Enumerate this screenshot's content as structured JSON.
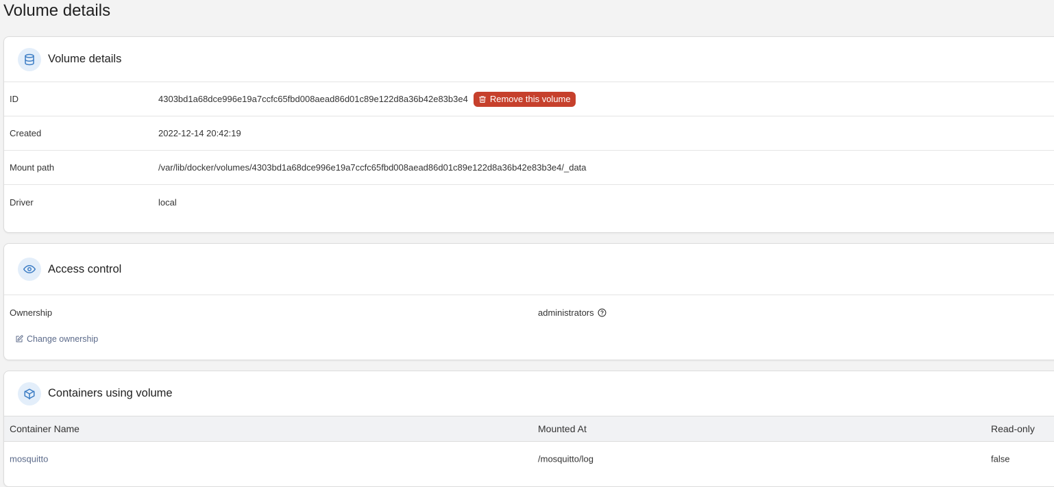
{
  "page": {
    "title": "Volume details"
  },
  "details": {
    "title": "Volume details",
    "id_label": "ID",
    "id_value": "4303bd1a68dce996e19a7ccfc65fbd008aead86d01c89e122d8a36b42e83b3e4",
    "remove_label": "Remove this volume",
    "created_label": "Created",
    "created_value": "2022-12-14 20:42:19",
    "mount_label": "Mount path",
    "mount_value": "/var/lib/docker/volumes/4303bd1a68dce996e19a7ccfc65fbd008aead86d01c89e122d8a36b42e83b3e4/_data",
    "driver_label": "Driver",
    "driver_value": "local"
  },
  "access": {
    "title": "Access control",
    "ownership_label": "Ownership",
    "ownership_value": "administrators",
    "change_label": "Change ownership"
  },
  "containers": {
    "title": "Containers using volume",
    "columns": [
      "Container Name",
      "Mounted At",
      "Read-only"
    ],
    "rows": [
      {
        "name": "mosquitto",
        "mounted_at": "/mosquitto/log",
        "read_only": "false"
      }
    ]
  },
  "colors": {
    "danger": "#c6402c",
    "link": "#5b6a8a",
    "icon_accent": "#3b7cc4",
    "icon_bg": "#e3eefa"
  },
  "icons": {
    "details": "database-icon",
    "access": "eye-icon",
    "containers": "box-icon",
    "remove": "trash-icon",
    "help": "help-circle-icon",
    "change": "edit-icon"
  }
}
